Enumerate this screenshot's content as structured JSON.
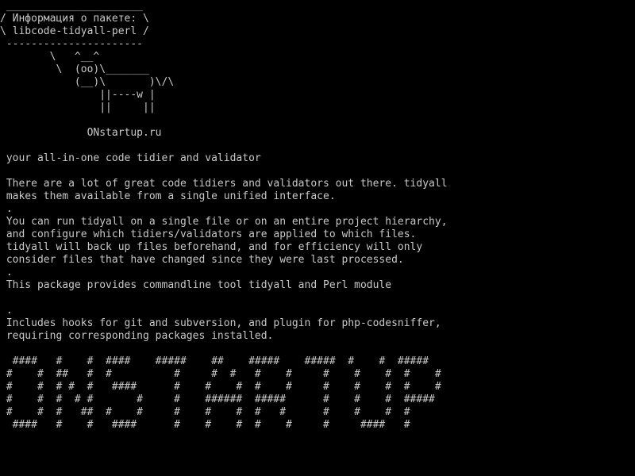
{
  "terminal": {
    "foreground": "#c8c8c8",
    "background": "#000000",
    "lines": [
      " ______________________",
      "/ Информация о пакете: \\",
      "\\ libcode-tidyall-perl /",
      " ----------------------",
      "        \\   ^__^",
      "         \\  (oo)\\_______",
      "            (__)\\       )\\/\\",
      "                ||----w |",
      "                ||     ||",
      "",
      "              ONstartup.ru",
      "",
      " your all-in-one code tidier and validator",
      "",
      " There are a lot of great code tidiers and validators out there. tidyall",
      " makes them available from a single unified interface.",
      " .",
      " You can run tidyall on a single file or on an entire project hierarchy,",
      " and configure which tidiers/validators are applied to which files.",
      " tidyall will back up files beforehand, and for efficiency will only",
      " consider files that have changed since they were last processed.",
      " .",
      " This package provides commandline tool tidyall and Perl module",
      "",
      " .",
      " Includes hooks for git and subversion, and plugin for php-codesniffer,",
      " requiring corresponding packages installed.",
      "",
      "  ####   #    #  ####    #####    ##    #####    #####  #    #  #####",
      " #    #  ##   #  #          #     #  #   #    #     #    #    #  #    #",
      " #    #  # #  #   ####      #    #    #  #    #     #    #    #  #    #",
      " #    #  #  # #       #     #    ######  #####      #    #    #  #####",
      " #    #  #   ##  #    #     #    #    #  #   #      #    #    #  #",
      "  ####   #    #   ####      #    #    #  #    #     #     ####   #"
    ]
  }
}
